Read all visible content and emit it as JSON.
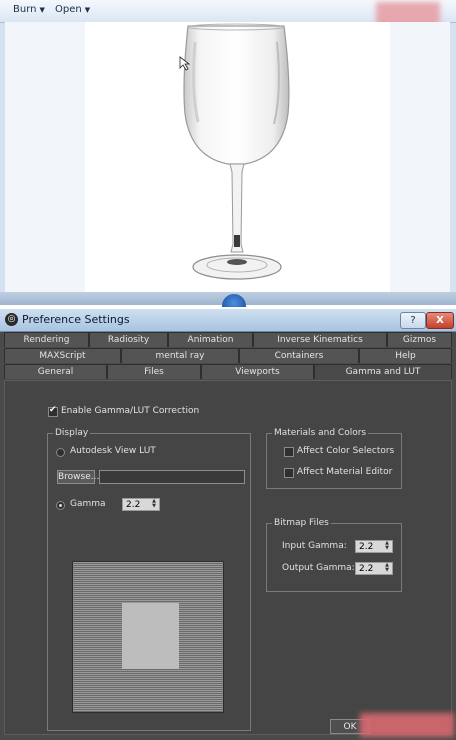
{
  "viewer": {
    "toolbar": {
      "burn_label": "Burn",
      "open_label": "Open"
    }
  },
  "dialog": {
    "title": "Preference Settings",
    "help_label": "?",
    "close_label": "X",
    "tabs": {
      "row1": [
        "Rendering",
        "Radiosity",
        "Animation",
        "Inverse Kinematics",
        "Gizmos"
      ],
      "row2": [
        "MAXScript",
        "mental ray",
        "Containers",
        "Help"
      ],
      "row3": [
        "General",
        "Files",
        "Viewports",
        "Gamma and LUT"
      ]
    },
    "active_tab": "Gamma and LUT",
    "enable_gamma_label": "Enable Gamma/LUT Correction",
    "enable_gamma_checked": true,
    "display": {
      "title": "Display",
      "lut_option": "Autodesk View LUT",
      "browse_label": "Browse...",
      "gamma_option": "Gamma",
      "gamma_value": "2.2",
      "selected": "Gamma"
    },
    "materials": {
      "title": "Materials and Colors",
      "affect_color_selectors": "Affect Color Selectors",
      "affect_material_editor": "Affect Material Editor"
    },
    "bitmap": {
      "title": "Bitmap Files",
      "input_gamma_label": "Input Gamma:",
      "input_gamma_value": "2.2",
      "output_gamma_label": "Output Gamma:",
      "output_gamma_value": "2.2"
    },
    "ok_label": "OK"
  }
}
